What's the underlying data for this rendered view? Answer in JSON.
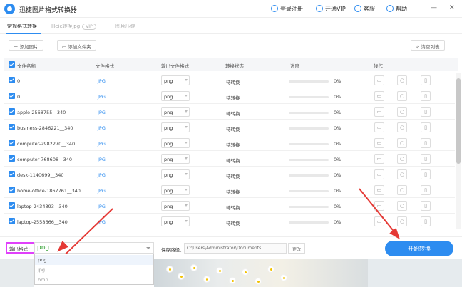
{
  "app": {
    "title": "迅捷图片格式转换器"
  },
  "top_links": {
    "login": "登录注册",
    "vip": "开通VIP",
    "service": "客服",
    "help": "帮助"
  },
  "window_controls": {
    "minimize": "—",
    "close": "✕"
  },
  "tabs": [
    {
      "label": "常规格式转换",
      "active": true
    },
    {
      "label": "Heic转换jpg",
      "badge": "VIP",
      "active": false
    },
    {
      "label": "图片压缩",
      "active": false
    }
  ],
  "toolbar": {
    "add_image": "添加图片",
    "add_folder": "添加文件夹",
    "clear_list": "清空列表"
  },
  "table": {
    "headers": [
      "文件名称",
      "文件格式",
      "输出文件格式",
      "转换状态",
      "进度",
      "操作"
    ],
    "rows": [
      {
        "name": "0",
        "format": "JPG",
        "output": "png",
        "status": "待转换",
        "progress": "0%"
      },
      {
        "name": "0",
        "format": "JPG",
        "output": "png",
        "status": "待转换",
        "progress": "0%"
      },
      {
        "name": "apple-2568755__340",
        "format": "JPG",
        "output": "png",
        "status": "待转换",
        "progress": "0%"
      },
      {
        "name": "business-2846221__340",
        "format": "JPG",
        "output": "png",
        "status": "待转换",
        "progress": "0%"
      },
      {
        "name": "computer-2982270__340",
        "format": "JPG",
        "output": "png",
        "status": "待转换",
        "progress": "0%"
      },
      {
        "name": "computer-768608__340",
        "format": "JPG",
        "output": "png",
        "status": "待转换",
        "progress": "0%"
      },
      {
        "name": "desk-1140699__340",
        "format": "JPG",
        "output": "png",
        "status": "待转换",
        "progress": "0%"
      },
      {
        "name": "home-office-1867761__340",
        "format": "JPG",
        "output": "png",
        "status": "待转换",
        "progress": "0%"
      },
      {
        "name": "laptop-2434393__340",
        "format": "JPG",
        "output": "png",
        "status": "待转换",
        "progress": "0%"
      },
      {
        "name": "laptop-2558666__340",
        "format": "JPG",
        "output": "png",
        "status": "待转换",
        "progress": "0%"
      }
    ]
  },
  "bottom": {
    "output_format_label": "输出格式：",
    "output_format_value": "png",
    "save_path_label": "保存路径：",
    "save_path_value": "C:\\Users\\Administrator\\Documents",
    "change_button": "更改",
    "start_button": "开始转换"
  },
  "dropdown_options": [
    "png",
    "jpg",
    "bmp"
  ],
  "colors": {
    "accent": "#2d8cf0",
    "highlight_box": "#e040fb",
    "annotation_arrow": "#e53935",
    "format_text": "#2a9d2a"
  },
  "icons": {
    "logo": "app-logo-icon",
    "user": "user-icon",
    "vip": "vip-icon",
    "service": "headset-icon",
    "help": "help-icon",
    "open": "folder-open-icon",
    "preview": "search-icon",
    "delete": "trash-icon"
  }
}
